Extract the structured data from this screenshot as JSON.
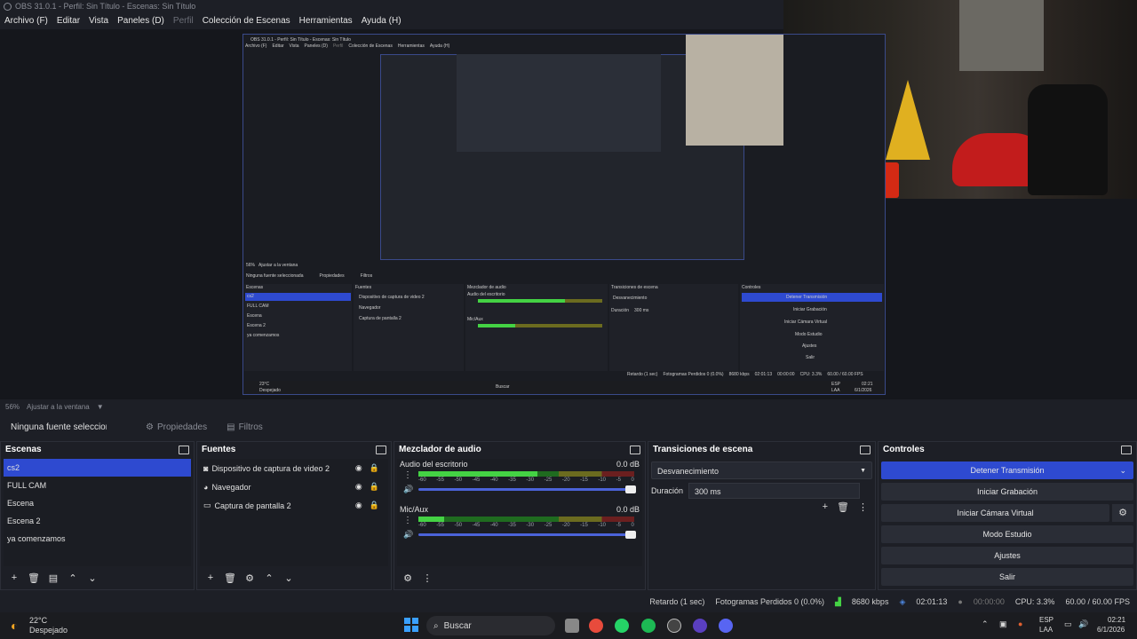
{
  "window": {
    "title": "OBS 31.0.1 - Perfil: Sin Título - Escenas: Sin Título"
  },
  "menu": [
    {
      "label": "Archivo (F)",
      "enabled": true
    },
    {
      "label": "Editar",
      "enabled": true
    },
    {
      "label": "Vista",
      "enabled": true
    },
    {
      "label": "Paneles (D)",
      "enabled": true
    },
    {
      "label": "Perfil",
      "enabled": false
    },
    {
      "label": "Colección de Escenas",
      "enabled": true
    },
    {
      "label": "Herramientas",
      "enabled": true
    },
    {
      "label": "Ayuda (H)",
      "enabled": true
    }
  ],
  "preview": {
    "zoom": "56%",
    "fit_label": "Ajustar a la ventana"
  },
  "source_toolbar": {
    "no_source": "Ninguna fuente seleccionada",
    "properties": "Propiedades",
    "filters": "Filtros"
  },
  "scenes": {
    "title": "Escenas",
    "items": [
      "cs2",
      "FULL CAM",
      "Escena",
      "Escena 2",
      "ya comenzamos"
    ],
    "selected": 0
  },
  "sources": {
    "title": "Fuentes",
    "items": [
      {
        "label": "Dispositivo de captura de video 2",
        "icon": "camera-icon"
      },
      {
        "label": "Navegador",
        "icon": "globe-icon"
      },
      {
        "label": "Captura de pantalla 2",
        "icon": "monitor-icon"
      }
    ]
  },
  "mixer": {
    "title": "Mezclador de audio",
    "scale": [
      "-60",
      "-55",
      "-50",
      "-45",
      "-40",
      "-35",
      "-30",
      "-25",
      "-20",
      "-15",
      "-10",
      "-5",
      "0"
    ],
    "tracks": [
      {
        "name": "Audio del escritorio",
        "db": "0.0 dB",
        "level": 0.55,
        "volume": 1.0
      },
      {
        "name": "Mic/Aux",
        "db": "0.0 dB",
        "level": 0.12,
        "volume": 1.0
      }
    ]
  },
  "transitions": {
    "title": "Transiciones de escena",
    "selected": "Desvanecimiento",
    "duration_label": "Duración",
    "duration": "300 ms"
  },
  "controls": {
    "title": "Controles",
    "buttons": [
      "Detener Transmisión",
      "Iniciar Grabación",
      "Iniciar Cámara Virtual",
      "Modo Estudio",
      "Ajustes",
      "Salir"
    ]
  },
  "status": {
    "delay": "Retardo (1 sec)",
    "dropped": "Fotogramas Perdidos 0 (0.0%)",
    "bitrate": "8680 kbps",
    "stream_time": "02:01:13",
    "rec_time": "00:00:00",
    "cpu": "CPU: 3.3%",
    "fps": "60.00 / 60.00 FPS"
  },
  "taskbar": {
    "temp": "22°C",
    "weather": "Despejado",
    "search": "Buscar",
    "lang": "ESP",
    "layout": "LAA",
    "time": "02:21",
    "date": "6/1/2026"
  },
  "nested": {
    "title": "OBS 31.0.1 - Perfil: Sin Título - Escenas: Sin Título",
    "menu": [
      "Archivo (F)",
      "Editar",
      "Vista",
      "Paneles (D)",
      "Perfil",
      "Colección de Escenas",
      "Herramientas",
      "Ayuda (H)"
    ],
    "zoom": "56%",
    "fit": "Ajustar a la ventana",
    "no_source": "Ninguna fuente seleccionada",
    "properties": "Propiedades",
    "filters": "Filtros",
    "docks": [
      "Escenas",
      "Fuentes",
      "Mezclador de audio",
      "Transiciones de escena",
      "Controles"
    ],
    "scenes": [
      "cs2",
      "FULL CAM",
      "Escena",
      "Escena 2",
      "ya comenzamos"
    ],
    "sources": [
      "Dispositivo de captura de video 2",
      "Navegador",
      "Captura de pantalla 2"
    ],
    "tracks": [
      "Audio del escritorio",
      "Mic/Aux"
    ],
    "transition": "Desvanecimiento",
    "duration_label": "Duración",
    "duration": "300 ms",
    "controls": [
      "Detener Transmisión",
      "Iniciar Grabación",
      "Iniciar Cámara Virtual",
      "Modo Estudio",
      "Ajustes",
      "Salir"
    ],
    "status": [
      "Retardo (1 sec)",
      "Fotogramas Perdidos 0 (0.0%)",
      "8680 kbps",
      "02:01:13",
      "00:00:00",
      "CPU: 3.3%",
      "60.00 / 60.00 FPS"
    ],
    "temp": "23°C",
    "weather": "Despejado",
    "search": "Buscar",
    "lang": "ESP",
    "layout": "LAA",
    "time": "02:21",
    "date": "6/1/2026"
  },
  "colors": {
    "accent": "#2e4ad0",
    "meter_green": "#44d244",
    "meter_yellow": "#c8c832",
    "meter_red": "#c83232"
  }
}
